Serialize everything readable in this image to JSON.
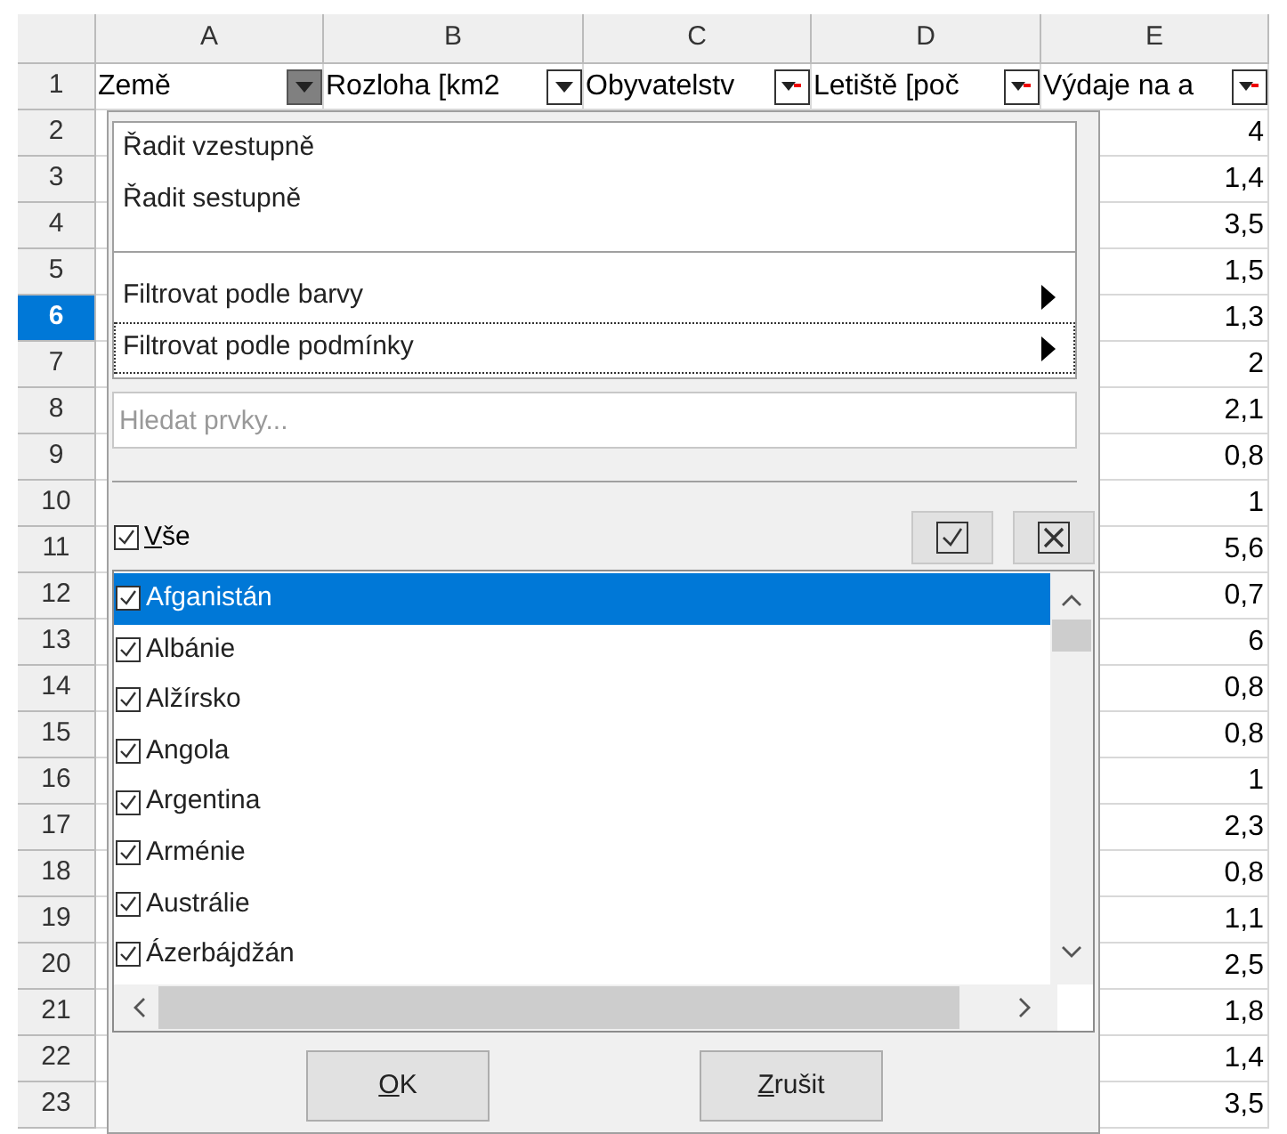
{
  "columns": [
    "A",
    "B",
    "C",
    "D",
    "E"
  ],
  "header_row": [
    {
      "text": "Země",
      "pressed": true,
      "filtered": false
    },
    {
      "text": "Rozloha [km2",
      "pressed": false,
      "filtered": false
    },
    {
      "text": "Obyvatelstv",
      "pressed": false,
      "filtered": true
    },
    {
      "text": "Letiště [poč",
      "pressed": false,
      "filtered": true
    },
    {
      "text": "Výdaje na a",
      "pressed": false,
      "filtered": true
    }
  ],
  "rows": [
    {
      "number": "1",
      "selected": false,
      "e": ""
    },
    {
      "number": "2",
      "selected": false,
      "e": "4"
    },
    {
      "number": "3",
      "selected": false,
      "e": "1,4"
    },
    {
      "number": "4",
      "selected": false,
      "e": "3,5"
    },
    {
      "number": "5",
      "selected": false,
      "e": "1,5"
    },
    {
      "number": "6",
      "selected": true,
      "e": "1,3"
    },
    {
      "number": "7",
      "selected": false,
      "e": "2"
    },
    {
      "number": "8",
      "selected": false,
      "e": "2,1"
    },
    {
      "number": "9",
      "selected": false,
      "e": "0,8"
    },
    {
      "number": "10",
      "selected": false,
      "e": "1"
    },
    {
      "number": "11",
      "selected": false,
      "e": "5,6"
    },
    {
      "number": "12",
      "selected": false,
      "e": "0,7"
    },
    {
      "number": "13",
      "selected": false,
      "e": "6"
    },
    {
      "number": "14",
      "selected": false,
      "e": "0,8"
    },
    {
      "number": "15",
      "selected": false,
      "e": "0,8"
    },
    {
      "number": "16",
      "selected": false,
      "e": "1"
    },
    {
      "number": "17",
      "selected": false,
      "e": "2,3"
    },
    {
      "number": "18",
      "selected": false,
      "e": "0,8"
    },
    {
      "number": "19",
      "selected": false,
      "e": "1,1"
    },
    {
      "number": "20",
      "selected": false,
      "e": "2,5"
    },
    {
      "number": "21",
      "selected": false,
      "e": "1,8"
    },
    {
      "number": "22",
      "selected": false,
      "e": "1,4"
    },
    {
      "number": "23",
      "selected": false,
      "e": "3,5"
    }
  ],
  "filter_popup": {
    "menu": [
      {
        "label": "Řadit vzestupně",
        "kind": "action",
        "focused": false
      },
      {
        "label": "Řadit sestupně",
        "kind": "action",
        "focused": false
      },
      {
        "kind": "separator"
      },
      {
        "label": "Filtrovat podle barvy",
        "kind": "submenu",
        "focused": false
      },
      {
        "label": "Filtrovat podle podmínky",
        "kind": "submenu",
        "focused": true
      }
    ],
    "search": {
      "placeholder": "Hledat prvky..."
    },
    "all": {
      "label": "Vše",
      "checked": true,
      "mnemonic": true
    },
    "values": [
      {
        "label": "Afganistán",
        "checked": true,
        "selected": true
      },
      {
        "label": "Albánie",
        "checked": true,
        "selected": false
      },
      {
        "label": "Alžírsko",
        "checked": true,
        "selected": false
      },
      {
        "label": "Angola",
        "checked": true,
        "selected": false
      },
      {
        "label": "Argentina",
        "checked": true,
        "selected": false
      },
      {
        "label": "Arménie",
        "checked": true,
        "selected": false
      },
      {
        "label": "Austrálie",
        "checked": true,
        "selected": false
      },
      {
        "label": "Ázerbájdžán",
        "checked": true,
        "selected": false
      }
    ],
    "buttons": [
      {
        "label": "OK",
        "mnemonic": true
      },
      {
        "label": "Zrušit",
        "mnemonic": true
      }
    ]
  }
}
